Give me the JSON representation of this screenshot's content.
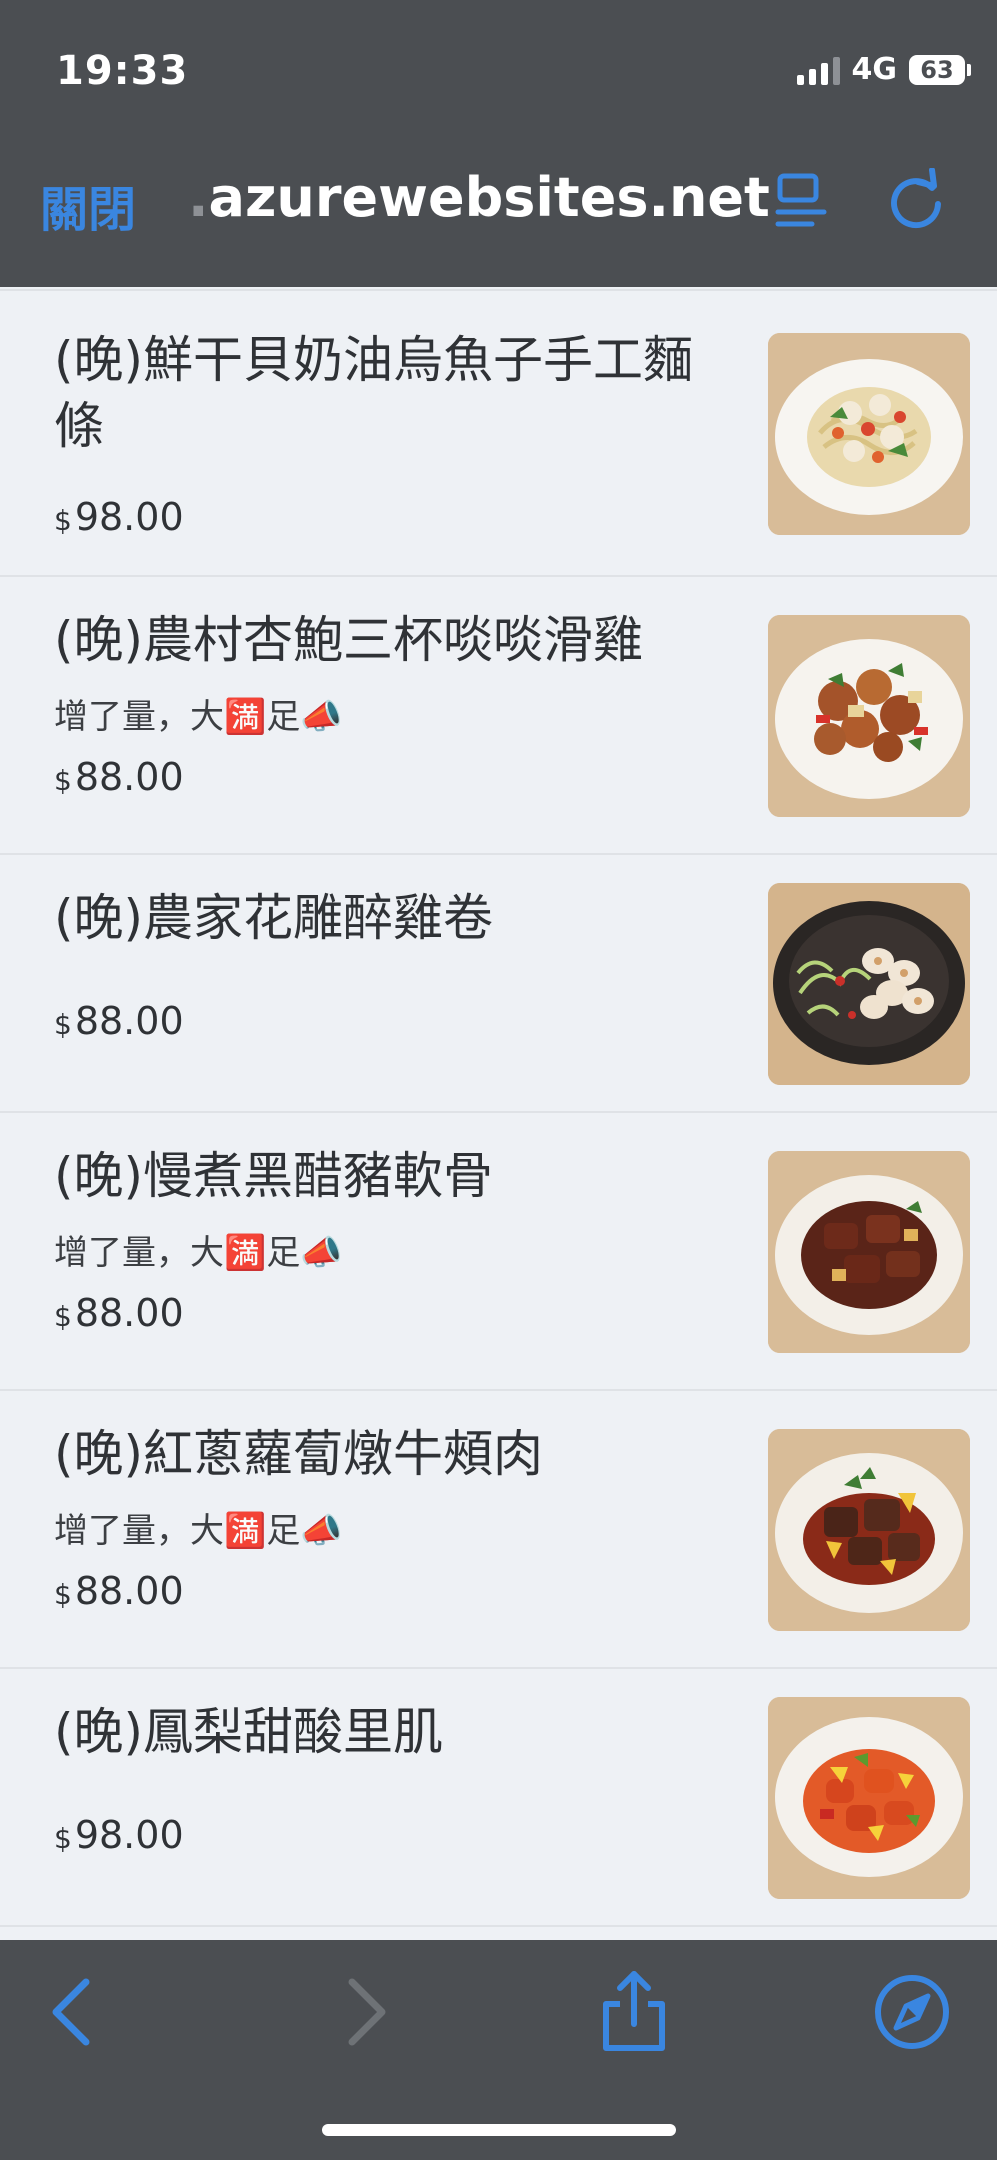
{
  "status": {
    "time": "19:33",
    "network": "4G",
    "battery": "63"
  },
  "browser": {
    "close_label": "關閉",
    "domain_prefix": ".",
    "domain": "azurewebsites.net",
    "accent_color": "#3a86e0"
  },
  "menu": [
    {
      "name": "(晚)鮮干貝奶油烏魚子手工麵條",
      "description": "",
      "currency": "$",
      "price": "98.00",
      "image": "pasta-dish"
    },
    {
      "name": "(晚)農村杏鮑三杯啖啖滑雞",
      "description": "增了量，大🈵足📣",
      "currency": "$",
      "price": "88.00",
      "image": "chicken-dish"
    },
    {
      "name": "(晚)農家花雕醉雞卷",
      "description": "",
      "currency": "$",
      "price": "88.00",
      "image": "chicken-roll-dish"
    },
    {
      "name": "(晚)慢煮黑醋豬軟骨",
      "description": "增了量，大🈵足📣",
      "currency": "$",
      "price": "88.00",
      "image": "pork-dish"
    },
    {
      "name": "(晚)紅蔥蘿蔔燉牛頰肉",
      "description": "增了量，大🈵足📣",
      "currency": "$",
      "price": "88.00",
      "image": "beef-dish"
    },
    {
      "name": "(晚)鳳梨甜酸里肌",
      "description": "",
      "currency": "$",
      "price": "98.00",
      "image": "sweet-sour-pork-dish"
    }
  ],
  "toolbar": {
    "back": "back-icon",
    "forward": "forward-icon",
    "share": "share-icon",
    "browser": "compass-icon"
  }
}
